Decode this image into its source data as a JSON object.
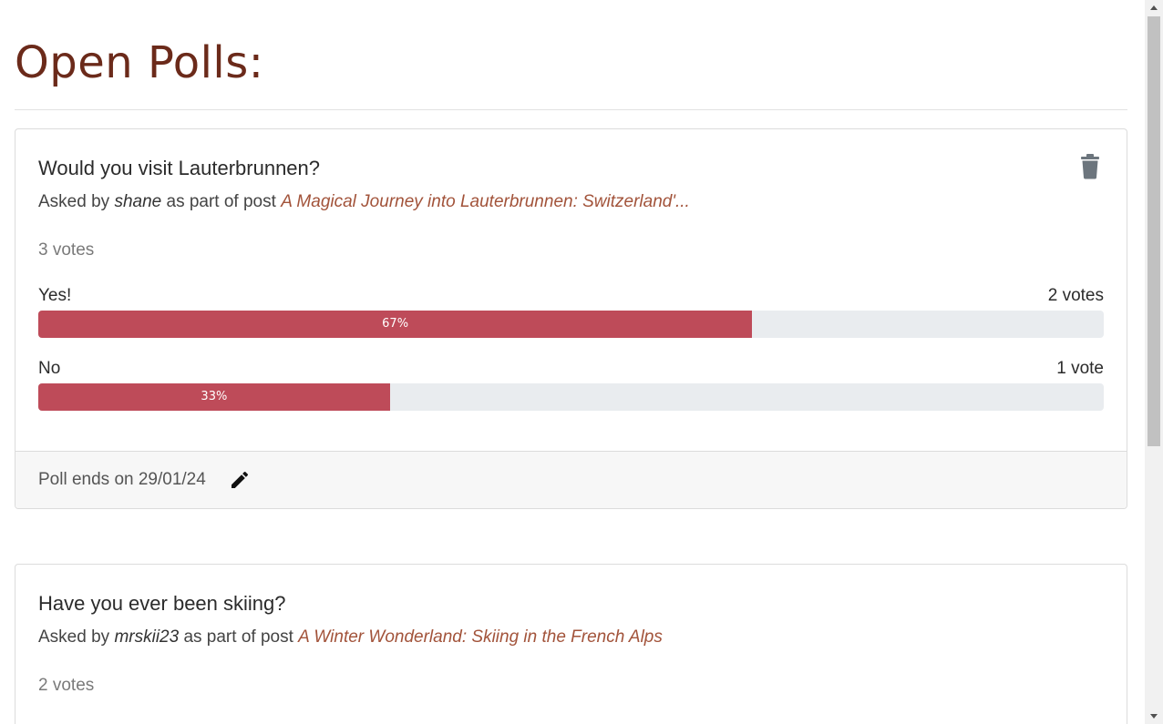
{
  "page": {
    "title": "Open Polls:"
  },
  "polls": [
    {
      "question": "Would you visit Lauterbrunnen?",
      "asked_prefix": "Asked by",
      "author": "shane",
      "post_prefix": "as part of post",
      "post_title": "A Magical Journey into Lauterbrunnen: Switzerland'...",
      "total_votes": "3 votes",
      "options": [
        {
          "label": "Yes!",
          "votes": "2 votes",
          "percent_label": "67%",
          "fraction": 0.67
        },
        {
          "label": "No",
          "votes": "1 vote",
          "percent_label": "33%",
          "fraction": 0.33
        }
      ],
      "footer": {
        "ends": "Poll ends on 29/01/24"
      },
      "icons": {
        "delete": "trash-icon",
        "edit": "pencil-icon"
      }
    },
    {
      "question": "Have you ever been skiing?",
      "asked_prefix": "Asked by",
      "author": "mrskii23",
      "post_prefix": "as part of post",
      "post_title": "A Winter Wonderland: Skiing in the French Alps",
      "total_votes": "2 votes"
    }
  ],
  "colors": {
    "title": "#6b2a1a",
    "link": "#a2533a",
    "bar_fill": "#be4b59",
    "bar_track": "#e9ecef"
  }
}
